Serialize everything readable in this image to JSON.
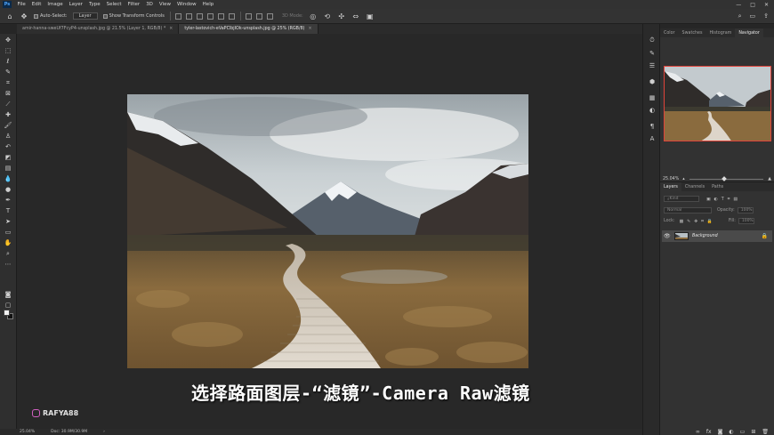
{
  "menu": {
    "logo": "Ps",
    "items": [
      "File",
      "Edit",
      "Image",
      "Layer",
      "Type",
      "Select",
      "Filter",
      "3D",
      "View",
      "Window",
      "Help"
    ],
    "window_controls": [
      "—",
      "□",
      "✕"
    ]
  },
  "options": {
    "auto_select_label": "Auto-Select:",
    "auto_select_value": "Layer",
    "show_transform_label": "Show Transform Controls",
    "mode_3d_label": "3D Mode:"
  },
  "tabs": [
    {
      "label": "amir-hanna-sweUf7FcyP4-unsplash.jpg @ 21.5% (Layer 1, RGB/8) *",
      "close": "×"
    },
    {
      "label": "tyler-lastovich-eVaPClbjIOk-unsplash.jpg @ 25% (RGB/8)",
      "close": "×"
    }
  ],
  "canvas": {
    "subtitle": "选择路面图层-“滤镜”-Camera Raw滤镜",
    "watermark": "RAFYA88"
  },
  "status": {
    "zoom": "25.04%",
    "doc": "Doc: 30.9M/30.9M",
    "arrow": "›"
  },
  "navigator": {
    "tabs": [
      "Color",
      "Swatches",
      "Histogram",
      "Navigator"
    ],
    "active_tab": "Navigator",
    "zoom": "25.04%"
  },
  "layers": {
    "tabs": [
      "Layers",
      "Channels",
      "Paths"
    ],
    "active_tab": "Layers",
    "kind_label": "Kind",
    "blend_mode": "Normal",
    "opacity_label": "Opacity:",
    "opacity_value": "100%",
    "lock_label": "Lock:",
    "fill_label": "Fill:",
    "fill_value": "100%",
    "layer_name": "Background"
  },
  "colors": {
    "accent_border": "#e0433a",
    "foreground": "#f2f2f2",
    "background": "#111111"
  }
}
